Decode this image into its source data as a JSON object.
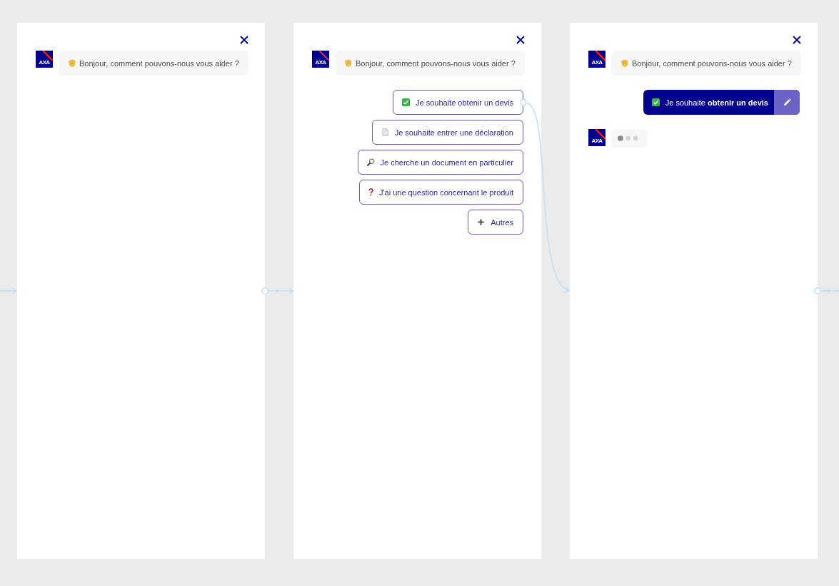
{
  "frames": [
    {
      "messages": [
        {
          "kind": "bot",
          "logo": "AXA",
          "text": "Bonjour, comment pouvons-nous vous aider ?"
        }
      ]
    },
    {
      "messages": [
        {
          "kind": "bot",
          "logo": "AXA",
          "text": "Bonjour, comment pouvons-nous vous aider ?"
        },
        {
          "kind": "choices",
          "options": [
            {
              "kind": "check",
              "label": "Je souhaite obtenir un devis",
              "linked": true
            },
            {
              "kind": "document",
              "label": "Je souhaite entrer une déclaration",
              "linked": false
            },
            {
              "kind": "search",
              "label": "Je cherche un document en particulier",
              "linked": false
            },
            {
              "kind": "question",
              "label": "J'ai une question concernant le produit",
              "linked": false
            },
            {
              "kind": "plus",
              "label": "Autres",
              "linked": false
            }
          ]
        }
      ]
    },
    {
      "messages": [
        {
          "kind": "bot",
          "logo": "AXA",
          "text": "Bonjour, comment pouvons-nous vous aider ?"
        },
        {
          "kind": "answer",
          "text": "Je souhaite **obtenir un devis**"
        },
        {
          "kind": "typing",
          "logo": "AXA"
        }
      ]
    }
  ]
}
